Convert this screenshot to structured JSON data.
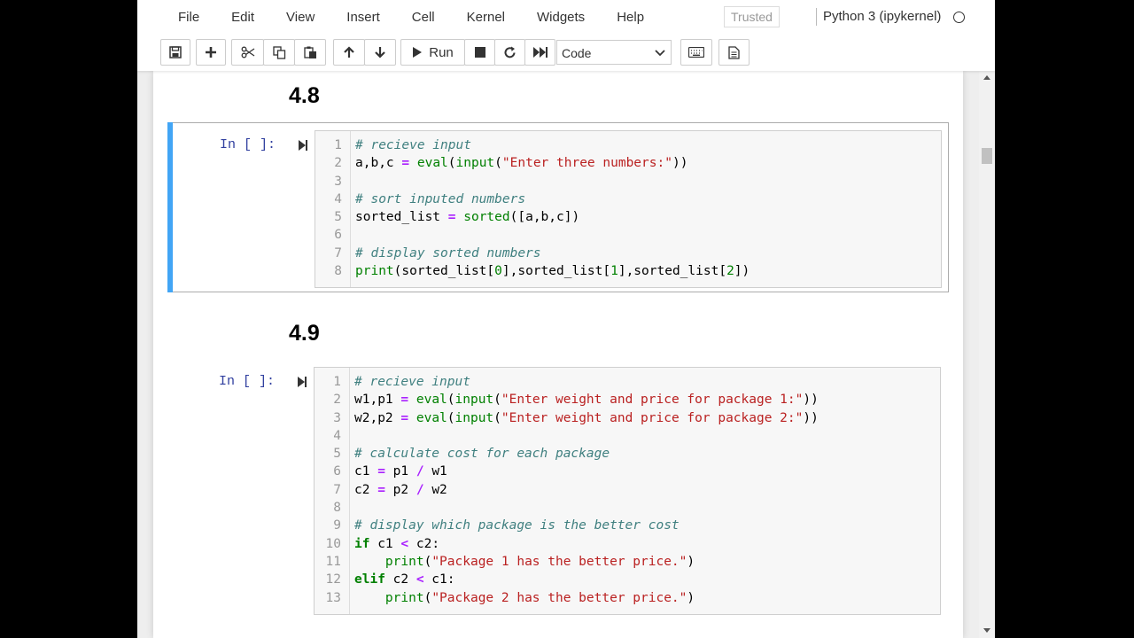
{
  "menu": [
    "File",
    "Edit",
    "View",
    "Insert",
    "Cell",
    "Kernel",
    "Widgets",
    "Help"
  ],
  "trusted_label": "Trusted",
  "kernel_name": "Python 3 (ipykernel)",
  "toolbar": {
    "run_label": "Run",
    "cell_type": "Code",
    "icons": [
      "save-icon",
      "plus-icon",
      "cut-icon",
      "copy-icon",
      "paste-icon",
      "arrow-up-icon",
      "arrow-down-icon",
      "play-icon",
      "stop-icon",
      "restart-icon",
      "fast-forward-icon",
      "keyboard-icon",
      "command-palette-icon"
    ]
  },
  "sections": [
    {
      "heading": "4.8",
      "prompt": "In [ ]:",
      "code": [
        "# recieve input",
        "a,b,c = eval(input(\"Enter three numbers:\"))",
        "",
        "# sort inputed numbers",
        "sorted_list = sorted([a,b,c])",
        "",
        "# display sorted numbers",
        "print(sorted_list[0],sorted_list[1],sorted_list[2])"
      ]
    },
    {
      "heading": "4.9",
      "prompt": "In [ ]:",
      "code": [
        "# recieve input",
        "w1,p1 = eval(input(\"Enter weight and price for package 1:\"))",
        "w2,p2 = eval(input(\"Enter weight and price for package 2:\"))",
        "",
        "# calculate cost for each package",
        "c1 = p1 / w1",
        "c2 = p2 / w2",
        "",
        "# display which package is the better cost",
        "if c1 < c2:",
        "    print(\"Package 1 has the better price.\")",
        "elif c2 < c1:",
        "    print(\"Package 2 has the better price.\")"
      ]
    }
  ]
}
